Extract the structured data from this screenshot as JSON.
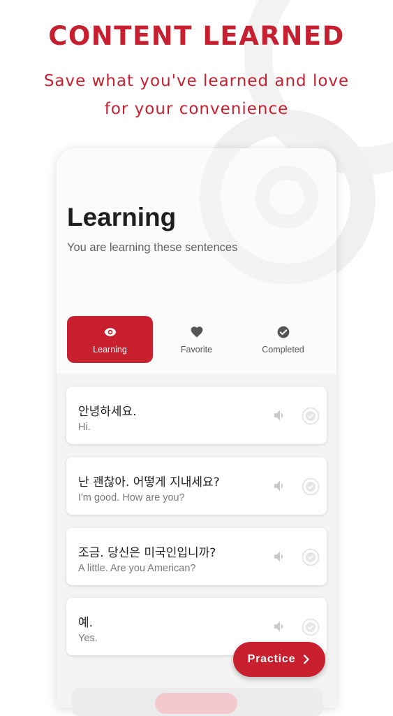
{
  "promo": {
    "headline": "CONTENT LEARNED",
    "subline_1": "Save what you've learned and love",
    "subline_2": "for your convenience"
  },
  "screen": {
    "title": "Learning",
    "subtitle": "You are learning these sentences"
  },
  "tabs": [
    {
      "label": "Learning",
      "icon": "eye-icon",
      "active": true
    },
    {
      "label": "Favorite",
      "icon": "heart-icon",
      "active": false
    },
    {
      "label": "Completed",
      "icon": "check-circle-icon",
      "active": false
    }
  ],
  "sentences": [
    {
      "korean": "안녕하세요.",
      "english": "Hi."
    },
    {
      "korean": "난 괜찮아. 어떻게 지내세요?",
      "english": "I'm good. How are you?"
    },
    {
      "korean": "조금. 당신은 미국인입니까?",
      "english": "A little. Are you American?"
    },
    {
      "korean": "예.",
      "english": "Yes."
    }
  ],
  "practice_button": {
    "label": "Practice",
    "icon": "chevron-right-icon"
  },
  "colors": {
    "accent": "#c8202f",
    "background": "#ffffff",
    "card": "#ffffff"
  }
}
